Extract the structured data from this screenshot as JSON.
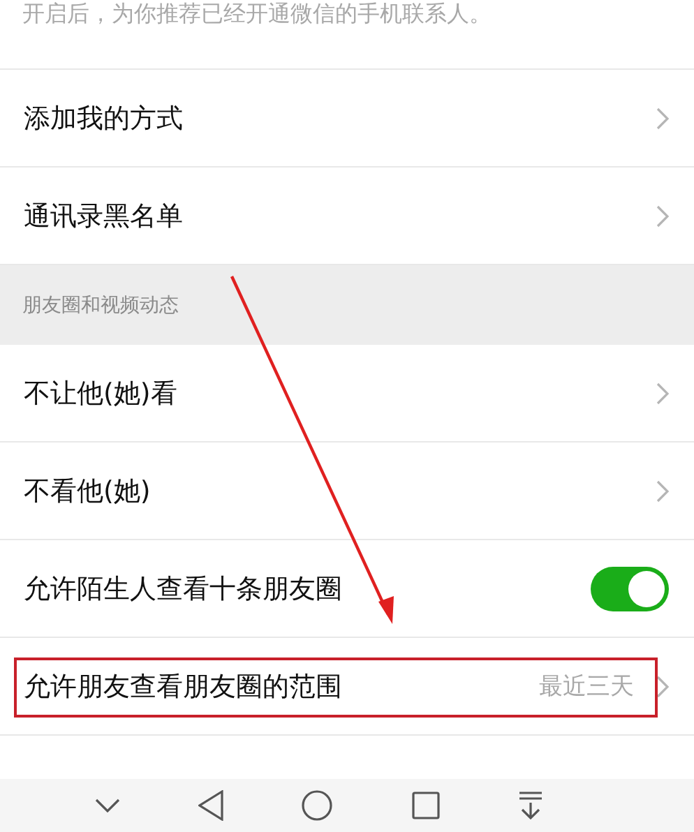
{
  "hint": "开启后，为你推荐已经开通微信的手机联系人。",
  "groups": [
    {
      "rows": [
        {
          "kind": "link",
          "label": "添加我的方式",
          "highlighted": false
        },
        {
          "kind": "link",
          "label": "通讯录黑名单",
          "highlighted": false
        }
      ]
    },
    {
      "header": "朋友圈和视频动态",
      "rows": [
        {
          "kind": "link",
          "label": "不让他(她)看",
          "highlighted": false
        },
        {
          "kind": "link",
          "label": "不看他(她)",
          "highlighted": false
        },
        {
          "kind": "toggle",
          "label": "允许陌生人查看十条朋友圈",
          "on": true,
          "highlighted": false
        },
        {
          "kind": "link",
          "label": "允许朋友查看朋友圈的范围",
          "value": "最近三天",
          "highlighted": true
        }
      ]
    }
  ],
  "annotation_arrow": true
}
